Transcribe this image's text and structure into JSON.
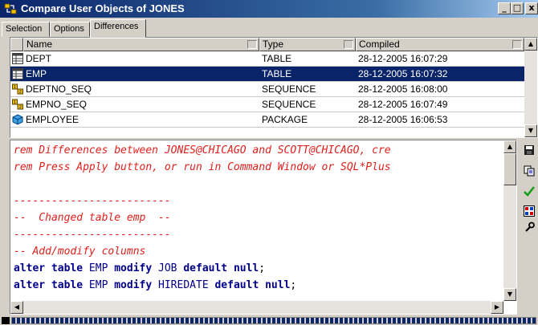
{
  "window": {
    "title": "Compare User Objects of JONES",
    "min_glyph": "_",
    "max_glyph": "□",
    "close_glyph": "x"
  },
  "tabs": [
    {
      "label": "Selection",
      "active": false
    },
    {
      "label": "Options",
      "active": false
    },
    {
      "label": "Differences",
      "active": true
    }
  ],
  "grid": {
    "columns": [
      "Name",
      "Type",
      "Compiled"
    ],
    "rows": [
      {
        "icon": "table-icon",
        "name": "DEPT",
        "type": "TABLE",
        "compiled": "28-12-2005 16:07:29",
        "selected": false
      },
      {
        "icon": "table-icon",
        "name": "EMP",
        "type": "TABLE",
        "compiled": "28-12-2005 16:07:32",
        "selected": true
      },
      {
        "icon": "sequence-icon",
        "name": "DEPTNO_SEQ",
        "type": "SEQUENCE",
        "compiled": "28-12-2005 16:08:00",
        "selected": false
      },
      {
        "icon": "sequence-icon",
        "name": "EMPNO_SEQ",
        "type": "SEQUENCE",
        "compiled": "28-12-2005 16:07:49",
        "selected": false
      },
      {
        "icon": "package-icon",
        "name": "EMPLOYEE",
        "type": "PACKAGE",
        "compiled": "28-12-2005 16:06:53",
        "selected": false
      }
    ]
  },
  "editor": {
    "lines": [
      {
        "kind": "comment",
        "text": "rem Differences between JONES@CHICAGO and SCOTT@CHICAGO, cre"
      },
      {
        "kind": "comment",
        "text": "rem Press Apply button, or run in Command Window or SQL*Plus"
      },
      {
        "kind": "blank",
        "text": ""
      },
      {
        "kind": "comment",
        "text": "-------------------------"
      },
      {
        "kind": "comment",
        "text": "--  Changed table emp  --"
      },
      {
        "kind": "comment",
        "text": "-------------------------"
      },
      {
        "kind": "comment",
        "text": "-- Add/modify columns"
      },
      {
        "kind": "sql",
        "parts": [
          {
            "t": "kw",
            "s": "alter table "
          },
          {
            "t": "id",
            "s": "EMP "
          },
          {
            "t": "kw",
            "s": "modify "
          },
          {
            "t": "id",
            "s": "JOB "
          },
          {
            "t": "kw",
            "s": "default null"
          },
          {
            "t": "plain",
            "s": ";"
          }
        ]
      },
      {
        "kind": "sql",
        "parts": [
          {
            "t": "kw",
            "s": "alter table "
          },
          {
            "t": "id",
            "s": "EMP "
          },
          {
            "t": "kw",
            "s": "modify "
          },
          {
            "t": "id",
            "s": "HIREDATE "
          },
          {
            "t": "kw",
            "s": "default null"
          },
          {
            "t": "plain",
            "s": ";"
          }
        ]
      }
    ]
  },
  "toolbar": {
    "buttons": [
      {
        "name": "save-icon",
        "glyph": "💾"
      },
      {
        "name": "copy-icon",
        "glyph": "⎘"
      },
      {
        "name": "apply-checkmark-icon",
        "glyph": "✓"
      },
      {
        "name": "compare-icon",
        "glyph": "▦"
      },
      {
        "name": "wrench-icon",
        "glyph": "🔧"
      }
    ]
  },
  "scroll": {
    "up": "▲",
    "down": "▼",
    "left": "◀",
    "right": "▶"
  },
  "colors": {
    "selection": "#0a246a",
    "comment": "#e0201c",
    "keyword": "#00008b",
    "check": "#1a9e1a"
  }
}
